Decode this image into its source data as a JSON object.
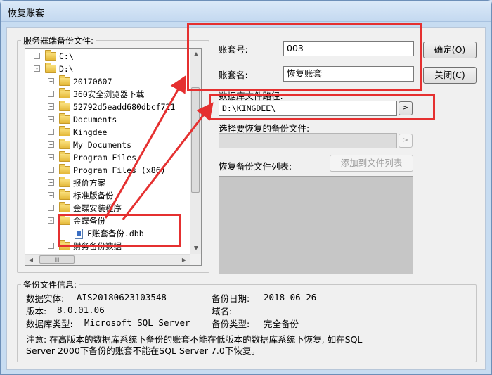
{
  "window": {
    "title": "恢复账套"
  },
  "server_files": {
    "group_label": "服务器端备份文件:",
    "tree": [
      {
        "label": "C:\\",
        "expander": "+"
      },
      {
        "label": "D:\\",
        "expander": "-"
      },
      {
        "label": "20170607",
        "expander": "+"
      },
      {
        "label": "360安全浏览器下载",
        "expander": "+"
      },
      {
        "label": "52792d5eadd680dbcf721",
        "expander": "+"
      },
      {
        "label": "Documents",
        "expander": "+"
      },
      {
        "label": "Kingdee",
        "expander": "+"
      },
      {
        "label": "My Documents",
        "expander": "+"
      },
      {
        "label": "Program Files",
        "expander": "+"
      },
      {
        "label": "Program Files (x86)",
        "expander": "+"
      },
      {
        "label": "报价方案",
        "expander": "+"
      },
      {
        "label": "标准版备份",
        "expander": "+"
      },
      {
        "label": "金蝶安装程序",
        "expander": "+"
      },
      {
        "label": "金蝶备份",
        "expander": "-"
      },
      {
        "label": "F账套备份.dbb",
        "expander": ""
      },
      {
        "label": "财务备份数据",
        "expander": "+"
      }
    ],
    "hscroll_thumb": "|||"
  },
  "form": {
    "account_no_label": "账套号:",
    "account_no_value": "003",
    "account_name_label": "账套名:",
    "account_name_value": "恢复账套",
    "db_path_label": "数据库文件路径:",
    "db_path_value": "D:\\KINGDEE\\",
    "browse_button": ">",
    "select_backup_label": "选择要恢复的备份文件:",
    "select_backup_button": ">",
    "list_label": "恢复备份文件列表:",
    "add_to_list_button": "添加到文件列表"
  },
  "buttons": {
    "ok": "确定(O)",
    "close": "关闭(C)"
  },
  "backup_info": {
    "group_label": "备份文件信息:",
    "entity_label": "数据实体:",
    "entity_value": "AIS20180623103548",
    "date_label": "备份日期:",
    "date_value": "2018-06-26",
    "version_label": "版本:",
    "version_value": "8.0.01.06",
    "domain_label": "域名:",
    "domain_value": "",
    "dbtype_label": "数据库类型:",
    "dbtype_value": "Microsoft SQL Server",
    "backup_type_label": "备份类型:",
    "backup_type_value": "完全备份",
    "note_line1": "注意: 在高版本的数据库系统下备份的账套不能在低版本的数据库系统下恢复, 如在SQL",
    "note_line2": "Server 2000下备份的账套不能在SQL Server 7.0下恢复。"
  },
  "colors": {
    "annotation": "#e53030"
  }
}
